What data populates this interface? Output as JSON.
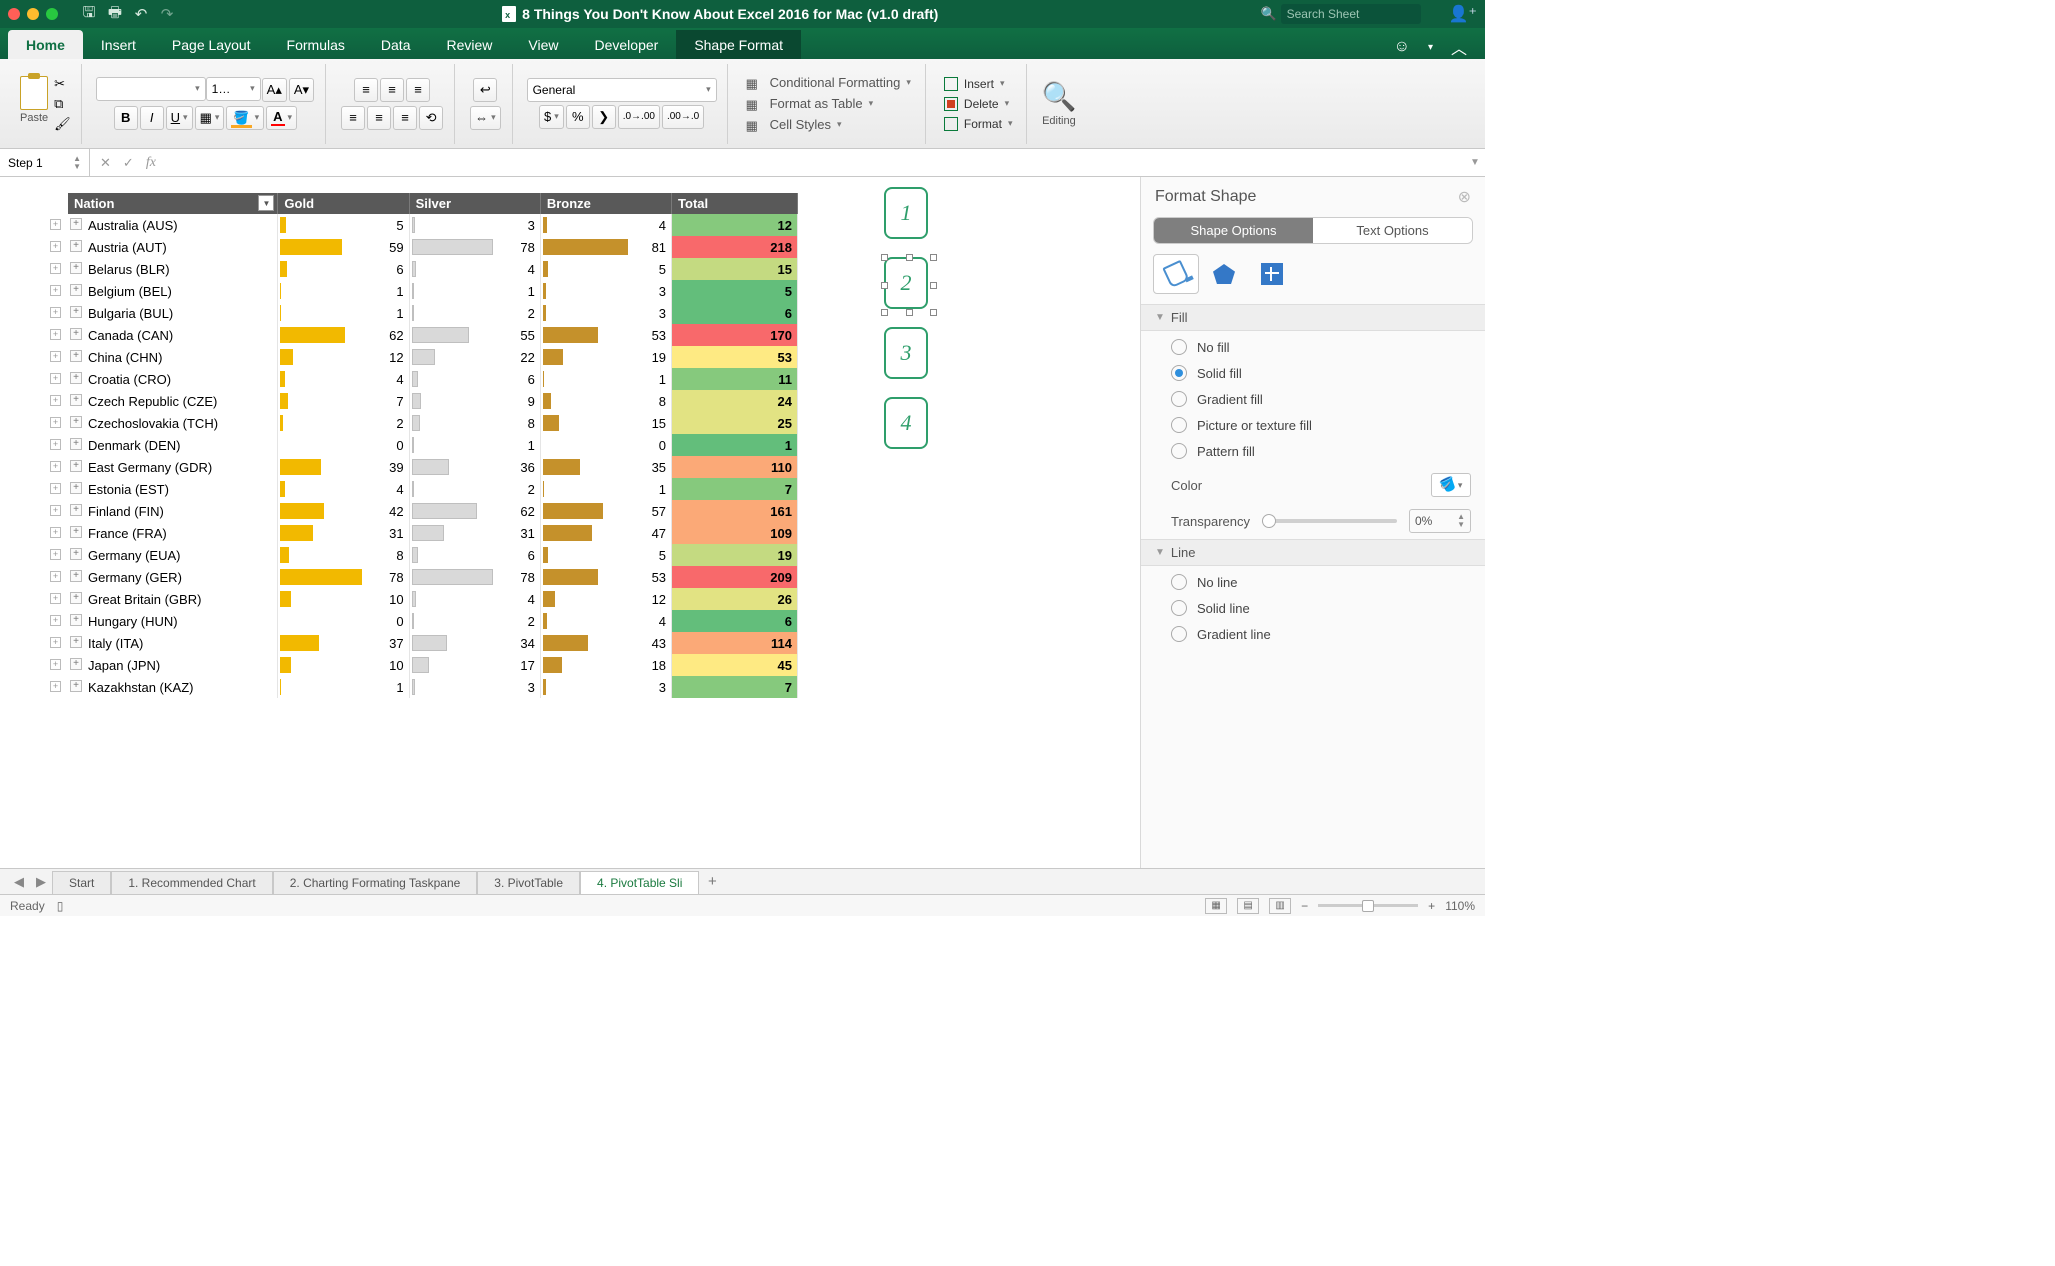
{
  "titlebar": {
    "document_title": "8 Things You Don't Know About Excel 2016 for Mac (v1.0 draft)",
    "search_placeholder": "Search Sheet"
  },
  "tabs": {
    "items": [
      "Home",
      "Insert",
      "Page Layout",
      "Formulas",
      "Data",
      "Review",
      "View",
      "Developer",
      "Shape Format"
    ],
    "active": "Home",
    "contextual": "Shape Format"
  },
  "ribbon": {
    "paste_label": "Paste",
    "font_name": "",
    "font_size": "1…",
    "number_format": "General",
    "cond_fmt": "Conditional Formatting",
    "fmt_table": "Format as Table",
    "cell_styles": "Cell Styles",
    "insert": "Insert",
    "delete": "Delete",
    "format": "Format",
    "editing": "Editing"
  },
  "formula_bar": {
    "name_box": "Step 1"
  },
  "pivot": {
    "headers": [
      "Nation",
      "Gold",
      "Silver",
      "Bronze",
      "Total"
    ],
    "rows": [
      {
        "nation": "Australia (AUS)",
        "gold": 5,
        "silver": 3,
        "bronze": 4,
        "total": 12
      },
      {
        "nation": "Austria (AUT)",
        "gold": 59,
        "silver": 78,
        "bronze": 81,
        "total": 218
      },
      {
        "nation": "Belarus (BLR)",
        "gold": 6,
        "silver": 4,
        "bronze": 5,
        "total": 15
      },
      {
        "nation": "Belgium (BEL)",
        "gold": 1,
        "silver": 1,
        "bronze": 3,
        "total": 5
      },
      {
        "nation": "Bulgaria (BUL)",
        "gold": 1,
        "silver": 2,
        "bronze": 3,
        "total": 6
      },
      {
        "nation": "Canada (CAN)",
        "gold": 62,
        "silver": 55,
        "bronze": 53,
        "total": 170
      },
      {
        "nation": "China (CHN)",
        "gold": 12,
        "silver": 22,
        "bronze": 19,
        "total": 53
      },
      {
        "nation": "Croatia (CRO)",
        "gold": 4,
        "silver": 6,
        "bronze": 1,
        "total": 11
      },
      {
        "nation": "Czech Republic (CZE)",
        "gold": 7,
        "silver": 9,
        "bronze": 8,
        "total": 24
      },
      {
        "nation": "Czechoslovakia (TCH)",
        "gold": 2,
        "silver": 8,
        "bronze": 15,
        "total": 25
      },
      {
        "nation": "Denmark (DEN)",
        "gold": 0,
        "silver": 1,
        "bronze": 0,
        "total": 1
      },
      {
        "nation": "East Germany (GDR)",
        "gold": 39,
        "silver": 36,
        "bronze": 35,
        "total": 110
      },
      {
        "nation": "Estonia (EST)",
        "gold": 4,
        "silver": 2,
        "bronze": 1,
        "total": 7
      },
      {
        "nation": "Finland (FIN)",
        "gold": 42,
        "silver": 62,
        "bronze": 57,
        "total": 161
      },
      {
        "nation": "France (FRA)",
        "gold": 31,
        "silver": 31,
        "bronze": 47,
        "total": 109
      },
      {
        "nation": "Germany (EUA)",
        "gold": 8,
        "silver": 6,
        "bronze": 5,
        "total": 19
      },
      {
        "nation": "Germany (GER)",
        "gold": 78,
        "silver": 78,
        "bronze": 53,
        "total": 209
      },
      {
        "nation": "Great Britain (GBR)",
        "gold": 10,
        "silver": 4,
        "bronze": 12,
        "total": 26
      },
      {
        "nation": "Hungary (HUN)",
        "gold": 0,
        "silver": 2,
        "bronze": 4,
        "total": 6
      },
      {
        "nation": "Italy (ITA)",
        "gold": 37,
        "silver": 34,
        "bronze": 43,
        "total": 114
      },
      {
        "nation": "Japan (JPN)",
        "gold": 10,
        "silver": 17,
        "bronze": 18,
        "total": 45
      },
      {
        "nation": "Kazakhstan (KAZ)",
        "gold": 1,
        "silver": 3,
        "bronze": 3,
        "total": 7
      }
    ],
    "max_medal": 81,
    "total_max": 218
  },
  "shape_boxes": [
    "1",
    "2",
    "3",
    "4"
  ],
  "pane": {
    "title": "Format Shape",
    "tab_shape": "Shape Options",
    "tab_text": "Text Options",
    "fill_head": "Fill",
    "fill_options": [
      "No fill",
      "Solid fill",
      "Gradient fill",
      "Picture or texture fill",
      "Pattern fill"
    ],
    "fill_selected": "Solid fill",
    "color_label": "Color",
    "transparency_label": "Transparency",
    "transparency_value": "0%",
    "line_head": "Line",
    "line_options": [
      "No line",
      "Solid line",
      "Gradient line"
    ]
  },
  "sheet_tabs": {
    "items": [
      "Start",
      "1. Recommended Chart",
      "2. Charting Formating Taskpane",
      "3. PivotTable",
      "4. PivotTable Sli"
    ],
    "active": "4. PivotTable Sli"
  },
  "status": {
    "ready": "Ready",
    "zoom": "110%"
  },
  "chart_data": {
    "type": "table",
    "title": "Winter Olympic medals by Nation (PivotTable with data bars and color scale)",
    "columns": [
      "Nation",
      "Gold",
      "Silver",
      "Bronze",
      "Total"
    ],
    "rows": [
      [
        "Australia (AUS)",
        5,
        3,
        4,
        12
      ],
      [
        "Austria (AUT)",
        59,
        78,
        81,
        218
      ],
      [
        "Belarus (BLR)",
        6,
        4,
        5,
        15
      ],
      [
        "Belgium (BEL)",
        1,
        1,
        3,
        5
      ],
      [
        "Bulgaria (BUL)",
        1,
        2,
        3,
        6
      ],
      [
        "Canada (CAN)",
        62,
        55,
        53,
        170
      ],
      [
        "China (CHN)",
        12,
        22,
        19,
        53
      ],
      [
        "Croatia (CRO)",
        4,
        6,
        1,
        11
      ],
      [
        "Czech Republic (CZE)",
        7,
        9,
        8,
        24
      ],
      [
        "Czechoslovakia (TCH)",
        2,
        8,
        15,
        25
      ],
      [
        "Denmark (DEN)",
        0,
        1,
        0,
        1
      ],
      [
        "East Germany (GDR)",
        39,
        36,
        35,
        110
      ],
      [
        "Estonia (EST)",
        4,
        2,
        1,
        7
      ],
      [
        "Finland (FIN)",
        42,
        62,
        57,
        161
      ],
      [
        "France (FRA)",
        31,
        31,
        47,
        109
      ],
      [
        "Germany (EUA)",
        8,
        6,
        5,
        19
      ],
      [
        "Germany (GER)",
        78,
        78,
        53,
        209
      ],
      [
        "Great Britain (GBR)",
        10,
        4,
        12,
        26
      ],
      [
        "Hungary (HUN)",
        0,
        2,
        4,
        6
      ],
      [
        "Italy (ITA)",
        37,
        34,
        43,
        114
      ],
      [
        "Japan (JPN)",
        10,
        17,
        18,
        45
      ],
      [
        "Kazakhstan (KAZ)",
        1,
        3,
        3,
        7
      ]
    ]
  }
}
